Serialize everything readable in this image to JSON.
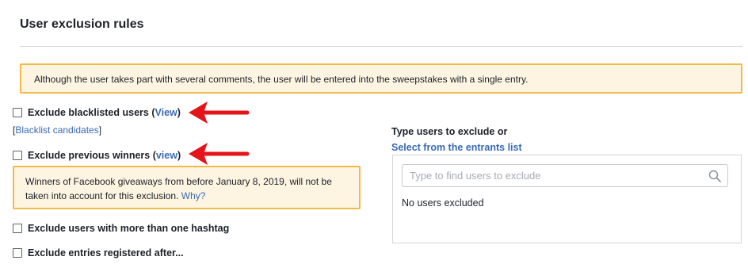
{
  "section": {
    "title": "User exclusion rules"
  },
  "notice": {
    "text": "Although the user takes part with several comments, the user will be entered into the sweepstakes with a single entry."
  },
  "options": {
    "blacklisted": {
      "label": "Exclude blacklisted users (",
      "link": "View",
      "suffix": ")",
      "checked": false
    },
    "blacklist_candidates": {
      "open": "[",
      "link": "Blacklist candidates",
      "close": "]"
    },
    "previous_winners": {
      "label": "Exclude previous winners (",
      "link": "view",
      "suffix": ")",
      "checked": false
    },
    "winners_note": {
      "text": "Winners of Facebook giveaways from before January 8, 2019, will not be taken into account for this exclusion. ",
      "link": "Why?"
    },
    "multi_hashtag": {
      "label": "Exclude users with more than one hashtag",
      "checked": false
    },
    "registered_after": {
      "label": "Exclude entries registered after...",
      "checked": false
    }
  },
  "exclude_panel": {
    "heading": "Type users to exclude or",
    "select_link": "Select from the entrants list",
    "search_placeholder": "Type to find users to exclude",
    "search_icon": "search-icon",
    "empty_text": "No users excluded"
  },
  "colors": {
    "accent_link": "#3a6ab5",
    "notice_border": "#f3b949",
    "notice_bg": "#fdf5e1",
    "arrow": "#e3141a"
  }
}
